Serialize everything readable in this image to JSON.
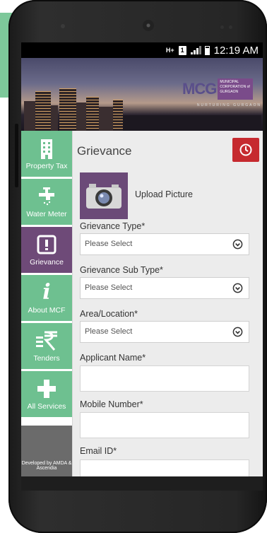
{
  "status_bar": {
    "network": "H+",
    "sim": "1",
    "time": "12:19 AM"
  },
  "banner": {
    "logo_text": "MCG",
    "logo_sub": "MUNICIPAL CORPORATION of GURGAON",
    "tagline": "NURTURING GURGAON"
  },
  "sidebar": {
    "items": [
      {
        "label": "Property Tax",
        "icon": "building-icon"
      },
      {
        "label": "Water Meter",
        "icon": "tap-icon"
      },
      {
        "label": "Grievance",
        "icon": "exclamation-icon",
        "active": true
      },
      {
        "label": "About MCF",
        "icon": "info-icon"
      },
      {
        "label": "Tenders",
        "icon": "rupee-icon"
      },
      {
        "label": "All Services",
        "icon": "plus-icon"
      }
    ],
    "credit": "Developed by AMDA & Ascendia"
  },
  "main": {
    "title": "Grievance",
    "upload_label": "Upload Picture",
    "fields": {
      "grievance_type": {
        "label": "Grievance Type*",
        "value": "Please Select"
      },
      "grievance_sub_type": {
        "label": "Grievance Sub Type*",
        "value": "Please Select"
      },
      "area_location": {
        "label": "Area/Location*",
        "value": "Please Select"
      },
      "applicant_name": {
        "label": "Applicant Name*",
        "value": ""
      },
      "mobile_number": {
        "label": "Mobile Number*",
        "value": ""
      },
      "email_id": {
        "label": "Email ID*",
        "value": ""
      }
    }
  },
  "colors": {
    "nav_green": "#6ec090",
    "nav_active_purple": "#6e4a78",
    "history_red": "#c62a2f"
  }
}
